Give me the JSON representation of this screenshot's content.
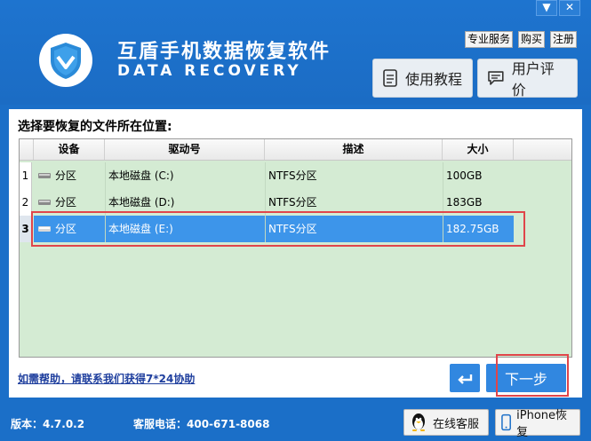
{
  "window": {
    "minimize": "▼",
    "close": "✕"
  },
  "header": {
    "title": "互盾手机数据恢复软件",
    "subtitle": "DATA RECOVERY",
    "links": [
      "专业服务",
      "购买",
      "注册"
    ],
    "tutorial": "使用教程",
    "review": "用户评价"
  },
  "main": {
    "label": "选择要恢复的文件所在位置:",
    "columns": [
      "设备",
      "驱动号",
      "描述",
      "大小"
    ],
    "rows": [
      {
        "num": "1",
        "device": "分区",
        "drive": "本地磁盘 (C:)",
        "desc": "NTFS分区",
        "size": "100GB"
      },
      {
        "num": "2",
        "device": "分区",
        "drive": "本地磁盘 (D:)",
        "desc": "NTFS分区",
        "size": "183GB"
      },
      {
        "num": "3",
        "device": "分区",
        "drive": "本地磁盘 (E:)",
        "desc": "NTFS分区",
        "size": "182.75GB"
      }
    ],
    "selected_row": 3,
    "help": "如需帮助，请联系我们获得7*24协助",
    "next": "下一步"
  },
  "footer": {
    "version": "版本：4.7.0.2",
    "phone": "客服电话：400-671-8068",
    "online": "在线客服",
    "iphone": "iPhone恢复"
  },
  "colors": {
    "brand": "#1b6fc8",
    "selected": "#3d95ea",
    "highlight": "#e0454a",
    "table_bg": "#d4ebd3"
  }
}
